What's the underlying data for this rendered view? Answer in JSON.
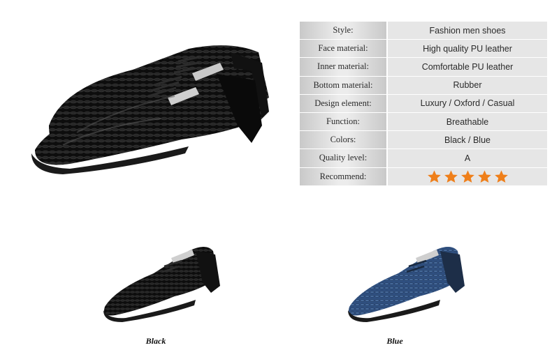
{
  "specs": [
    {
      "label": "Style:",
      "value": "Fashion men shoes"
    },
    {
      "label": "Face material:",
      "value": "High quality PU leather"
    },
    {
      "label": "Inner material:",
      "value": "Comfortable PU leather"
    },
    {
      "label": "Bottom material:",
      "value": "Rubber"
    },
    {
      "label": "Design element:",
      "value": "Luxury / Oxford / Casual"
    },
    {
      "label": "Function:",
      "value": "Breathable"
    },
    {
      "label": "Colors:",
      "value": "Black / Blue"
    },
    {
      "label": "Quality level:",
      "value": "A"
    },
    {
      "label": "Recommend:",
      "rating": 5,
      "rating_max": 5
    }
  ],
  "variants": [
    {
      "caption": "Black",
      "color": "#111111"
    },
    {
      "caption": "Blue",
      "color": "#2f4f7f"
    }
  ],
  "colors": {
    "star": "#ef7f1a",
    "table_value_bg": "#e6e6e6"
  },
  "icons": {
    "rating": "star-icon"
  }
}
